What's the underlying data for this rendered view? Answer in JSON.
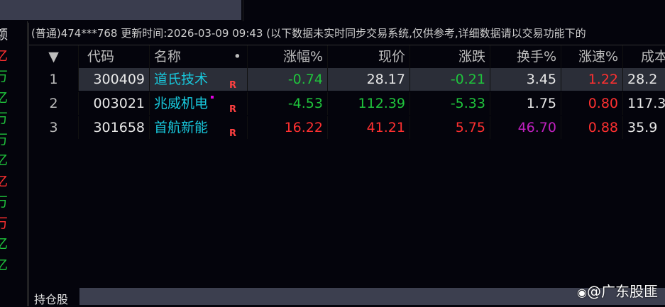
{
  "left_labels": [
    {
      "t": "额",
      "c": "#e8e8e8"
    },
    {
      "t": "亿",
      "c": "#ff3030"
    },
    {
      "t": "万",
      "c": "#1fc43c"
    },
    {
      "t": "亿",
      "c": "#1fc43c"
    },
    {
      "t": "万",
      "c": "#1fc43c"
    },
    {
      "t": "万",
      "c": "#1fc43c"
    },
    {
      "t": "亿",
      "c": "#1fc43c"
    },
    {
      "t": "亿",
      "c": "#ff3030"
    },
    {
      "t": "万",
      "c": "#1fc43c"
    },
    {
      "t": "万",
      "c": "#ff3030"
    },
    {
      "t": "亿",
      "c": "#1fc43c"
    },
    {
      "t": "亿",
      "c": "#1fc43c"
    }
  ],
  "info": "(普通)474***768 更新时间:2026-03-09 09:43 (以下数据未实时同步交易系统,仅供参考,详细数据请以交易功能下的",
  "headers": {
    "sort": "▼",
    "code": "代码",
    "name": "名称",
    "dot": "•",
    "pct": "涨幅%",
    "price": "现价",
    "chg": "涨跌",
    "turnover": "换手%",
    "speed": "涨速%",
    "cost": "成本"
  },
  "rows": [
    {
      "idx": "1",
      "code": "300409",
      "name": "道氏技术",
      "flag": "R",
      "pct": "-0.74",
      "price": "28.17",
      "chg": "-0.21",
      "turnover": "3.45",
      "speed": "1.22",
      "cost": "28.2"
    },
    {
      "idx": "2",
      "code": "003021",
      "name": "兆威机电",
      "flag": "R",
      "pct": "-4.53",
      "price": "112.39",
      "chg": "-5.33",
      "turnover": "1.75",
      "speed": "0.80",
      "cost": "117.3"
    },
    {
      "idx": "3",
      "code": "301658",
      "name": "首航新能",
      "flag": "R",
      "pct": "16.22",
      "price": "41.21",
      "chg": "5.75",
      "turnover": "46.70",
      "speed": "0.88",
      "cost": "35.9"
    }
  ],
  "tab": "持仓股",
  "watermark": "@广东股匪"
}
